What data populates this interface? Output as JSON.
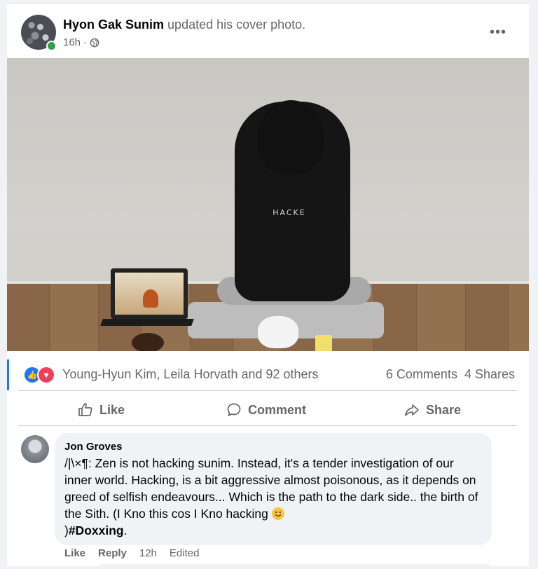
{
  "post": {
    "author": "Hyon Gak Sunim",
    "action": "updated his cover photo.",
    "time": "16h",
    "separator": "·",
    "more_label": "•••",
    "photo_text": "HACKE"
  },
  "reactions": {
    "like_glyph": "👍",
    "love_glyph": "♥",
    "reactors": "Young-Hyun Kim, Leila Horvath and 92 others",
    "comments": "6 Comments",
    "shares": "4 Shares"
  },
  "actions": {
    "like": "Like",
    "comment": "Comment",
    "share": "Share"
  },
  "comment": {
    "author": "Jon Groves",
    "text": "/|\\×¶: Zen is not hacking sunim. Instead, it's a tender investigation of our inner world. Hacking, is a bit aggressive almost poisonous, as it depends on greed of selfish endeavours... Which is the path to the dark side.. the birth of the Sith. (I Kno this cos I Kno hacking",
    "text_tail": ")",
    "hashtag": "#Doxxing",
    "end": ".",
    "like": "Like",
    "reply": "Reply",
    "time": "12h",
    "edited": "Edited"
  },
  "colors": {
    "accent": "#1877f2",
    "love": "#f33e58",
    "online": "#31a24c",
    "muted_text": "#65676b"
  },
  "icons": [
    "globe-icon",
    "more-icon",
    "like-icon",
    "love-icon",
    "thumbs-up-icon",
    "comment-icon",
    "share-icon",
    "smile-emoji-icon"
  ]
}
